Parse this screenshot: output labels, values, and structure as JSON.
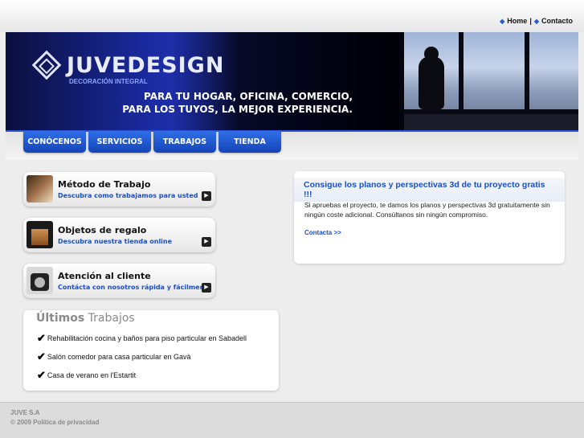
{
  "toplinks": {
    "home": "Home",
    "separator": "|",
    "contact": "Contacto"
  },
  "brand": {
    "name": "JUVEDESIGN",
    "subtitle": "DECORACIÓN INTEGRAL",
    "tagline_1": "PARA TU HOGAR, OFICINA, COMERCIO,",
    "tagline_2": "PARA LOS TUYOS, LA MEJOR EXPERIENCIA."
  },
  "nav": [
    "CONÓCENOS",
    "SERVICIOS",
    "TRABAJOS",
    "TIENDA"
  ],
  "cards": [
    {
      "title": "Método de Trabajo",
      "subtitle": "Descubra como trabajamos para usted",
      "icon": "furniture-photo-icon"
    },
    {
      "title": "Objetos de regalo",
      "subtitle": "Descubra nuestra tienda online",
      "icon": "gift-bag-icon"
    },
    {
      "title": "Atención al cliente",
      "subtitle": "Contácta con nosotros rápida y fácilmente",
      "icon": "telephone-icon"
    }
  ],
  "latest": {
    "heading_bold": "Últimos",
    "heading_rest": "Trabajos",
    "items": [
      "Rehabilitación cocina y baños para piso particular en Sabadell",
      "Salón comedor para casa particular en Gavà",
      "Casa de verano en l'Estartit"
    ]
  },
  "promo": {
    "title": "Consigue los planos y perspectivas 3d de tu proyecto gratis !!!",
    "body": "Si apruebas el proyecto, te damos los planos y perspectivas 3d gratuitamente sin ningún coste adicional. Consúltanos sin ningún compromiso.",
    "link": "Contacta >>"
  },
  "footer": {
    "company": "JUVE S.A",
    "copyright": "© 2009 Politica de privacidad"
  },
  "colors": {
    "accent": "#1a4fc8",
    "nav": "#2a62dc",
    "footer_text": "#8a8a8a"
  }
}
